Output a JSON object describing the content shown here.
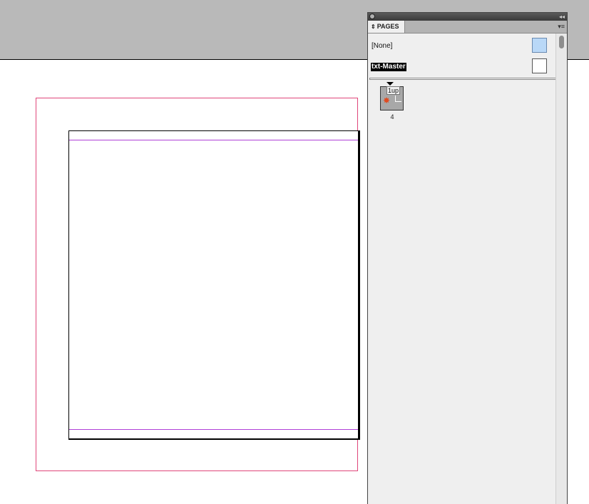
{
  "panel": {
    "tab_label": "PAGES",
    "tab_arrows": "⇕",
    "collapse_glyph": "◂◂",
    "menu_glyph": "▾≡",
    "masters": [
      {
        "label": "[None]",
        "selected": false
      },
      {
        "label": "txt-Master",
        "selected": true
      }
    ],
    "pages": [
      {
        "number": "4",
        "master_label": "1up"
      }
    ]
  },
  "colors": {
    "bleed_guide": "#e0467a",
    "margin_guide": "#b040d8",
    "pasteboard": "#b9b9b9",
    "master_thumb_none": "#b9d8f7"
  },
  "icons": [
    "close-icon",
    "collapse-icon",
    "panel-menu-icon",
    "page-marker-icon",
    "thumb-star-icon"
  ]
}
